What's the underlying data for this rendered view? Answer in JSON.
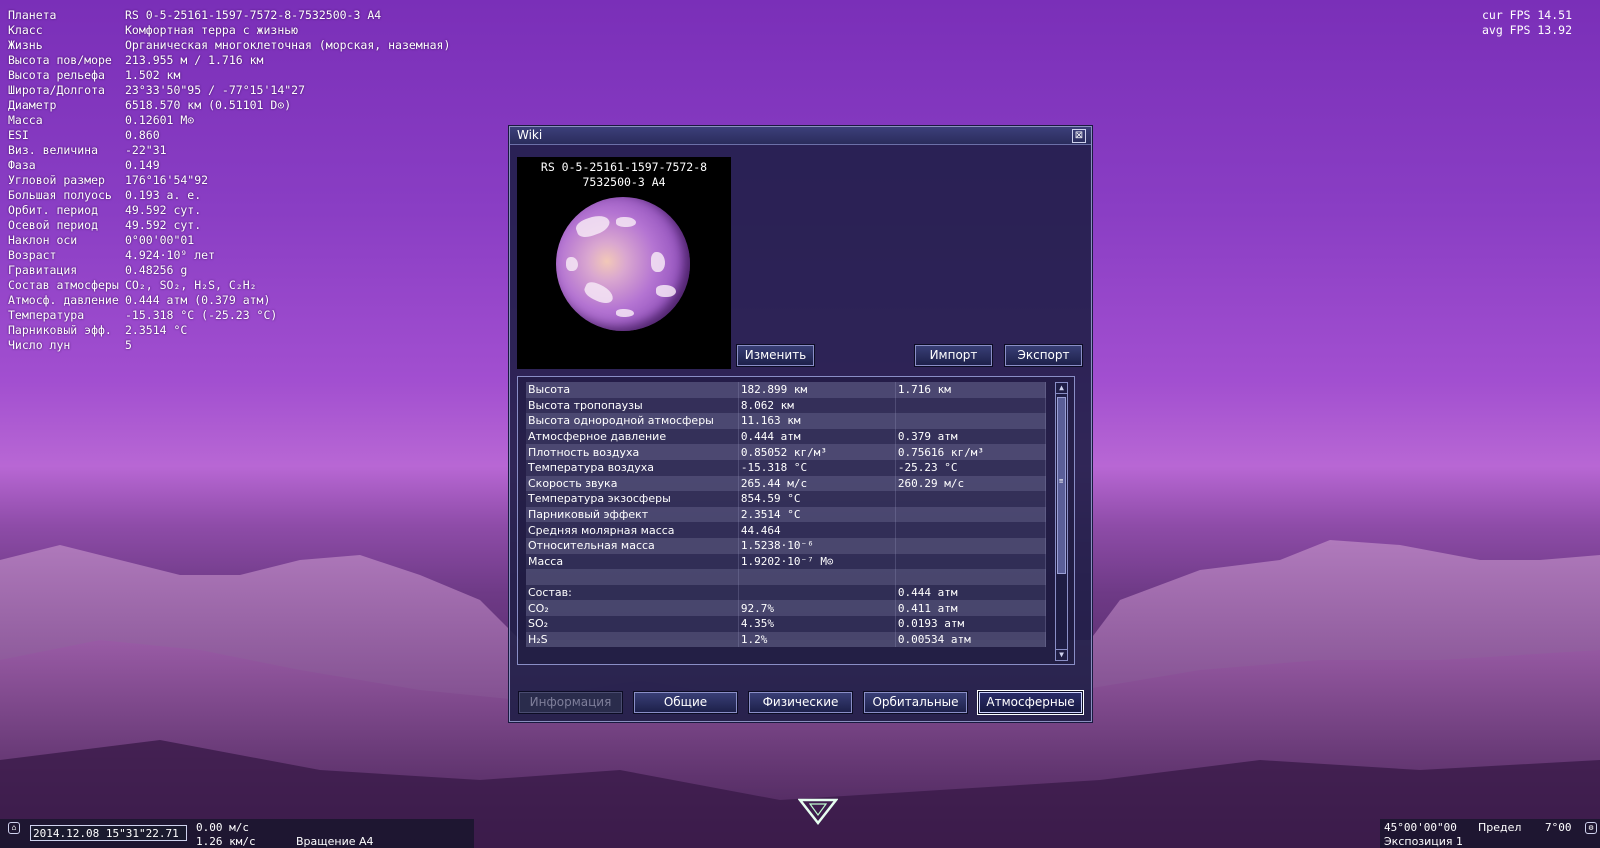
{
  "planet_info": [
    {
      "k": "Планета",
      "v": "RS 0-5-25161-1597-7572-8-7532500-3 A4"
    },
    {
      "k": "Класс",
      "v": "Комфортная терра с жизнью"
    },
    {
      "k": "Жизнь",
      "v": "Органическая многоклеточная (морская, наземная)"
    },
    {
      "k": "Высота пов/море",
      "v": "213.955 м / 1.716 км"
    },
    {
      "k": "Высота рельефа",
      "v": "1.502 км"
    },
    {
      "k": "Широта/Долгота",
      "v": "23°33'50\"95 / -77°15'14\"27"
    },
    {
      "k": "Диаметр",
      "v": "6518.570 км (0.51101 D⊙)"
    },
    {
      "k": "Масса",
      "v": "0.12601 M⊙"
    },
    {
      "k": "ESI",
      "v": "0.860"
    },
    {
      "k": "Виз. величина",
      "v": "-22\"31"
    },
    {
      "k": "Фаза",
      "v": "0.149"
    },
    {
      "k": "Угловой размер",
      "v": "176°16'54\"92"
    },
    {
      "k": "Большая полуось",
      "v": "0.193 а. е."
    },
    {
      "k": "Орбит. период",
      "v": "49.592 сут."
    },
    {
      "k": "Осевой период",
      "v": "49.592 сут."
    },
    {
      "k": "Наклон оси",
      "v": "0°00'00\"01"
    },
    {
      "k": "Возраст",
      "v": "4.924·10⁹ лет"
    },
    {
      "k": "Гравитация",
      "v": "0.48256 g"
    },
    {
      "k": "Состав атмосферы",
      "v": "CO₂, SO₂, H₂S, C₂H₂"
    },
    {
      "k": "Атмосф. давление",
      "v": "0.444 атм (0.379 атм)"
    },
    {
      "k": "Температура",
      "v": "-15.318 °C (-25.23 °C)"
    },
    {
      "k": "Парниковый эфф.",
      "v": "2.3514 °C"
    },
    {
      "k": "Число лун",
      "v": "5"
    }
  ],
  "fps": {
    "cur": "cur FPS 14.51",
    "avg": "avg FPS 13.92"
  },
  "wiki": {
    "title": "Wiki",
    "close": "⊠",
    "preview_title_1": "RS 0-5-25161-1597-7572-8",
    "preview_title_2": "7532500-3 A4",
    "buttons": {
      "edit": "Изменить",
      "import": "Импорт",
      "export": "Экспорт"
    },
    "table": [
      [
        "Высота",
        "182.899 км",
        "1.716 км"
      ],
      [
        "Высота тропопаузы",
        "8.062 км",
        ""
      ],
      [
        "Высота однородной атмосферы",
        "11.163 км",
        ""
      ],
      [
        "Атмосферное давление",
        "0.444 атм",
        "0.379 атм"
      ],
      [
        "Плотность воздуха",
        "0.85052 кг/м³",
        "0.75616 кг/м³"
      ],
      [
        "Температура воздуха",
        "-15.318 °C",
        "-25.23 °C"
      ],
      [
        "Скорость звука",
        "265.44 м/с",
        "260.29 м/с"
      ],
      [
        "Температура экзосферы",
        "854.59 °C",
        ""
      ],
      [
        "Парниковый эффект",
        "2.3514 °C",
        ""
      ],
      [
        "Средняя молярная масса",
        "44.464",
        ""
      ],
      [
        "Относительная масса",
        "1.5238·10⁻⁶",
        ""
      ],
      [
        "Масса",
        "1.9202·10⁻⁷ M⊙",
        ""
      ],
      [
        "",
        "",
        ""
      ],
      [
        "Состав:",
        "",
        "0.444 атм"
      ],
      [
        "CO₂",
        "92.7%",
        "0.411 атм"
      ],
      [
        "SO₂",
        "4.35%",
        "0.0193 атм"
      ],
      [
        "H₂S",
        "1.2%",
        "0.00534 атм"
      ]
    ],
    "tabs": {
      "info": "Информация",
      "general": "Общие",
      "physical": "Физические",
      "orbital": "Орбитальные",
      "atmospheric": "Атмосферные"
    }
  },
  "bottom": {
    "date": "2014.12.08  15\"31\"22.71",
    "speed1": "0.00  м/с",
    "speed2": "1.26  км/с",
    "mode": "Вращение A4",
    "angle": "45°00'00\"00",
    "limit_label": "Предел",
    "limit_value": "7°00",
    "exposure": "Экспозиция 1"
  }
}
